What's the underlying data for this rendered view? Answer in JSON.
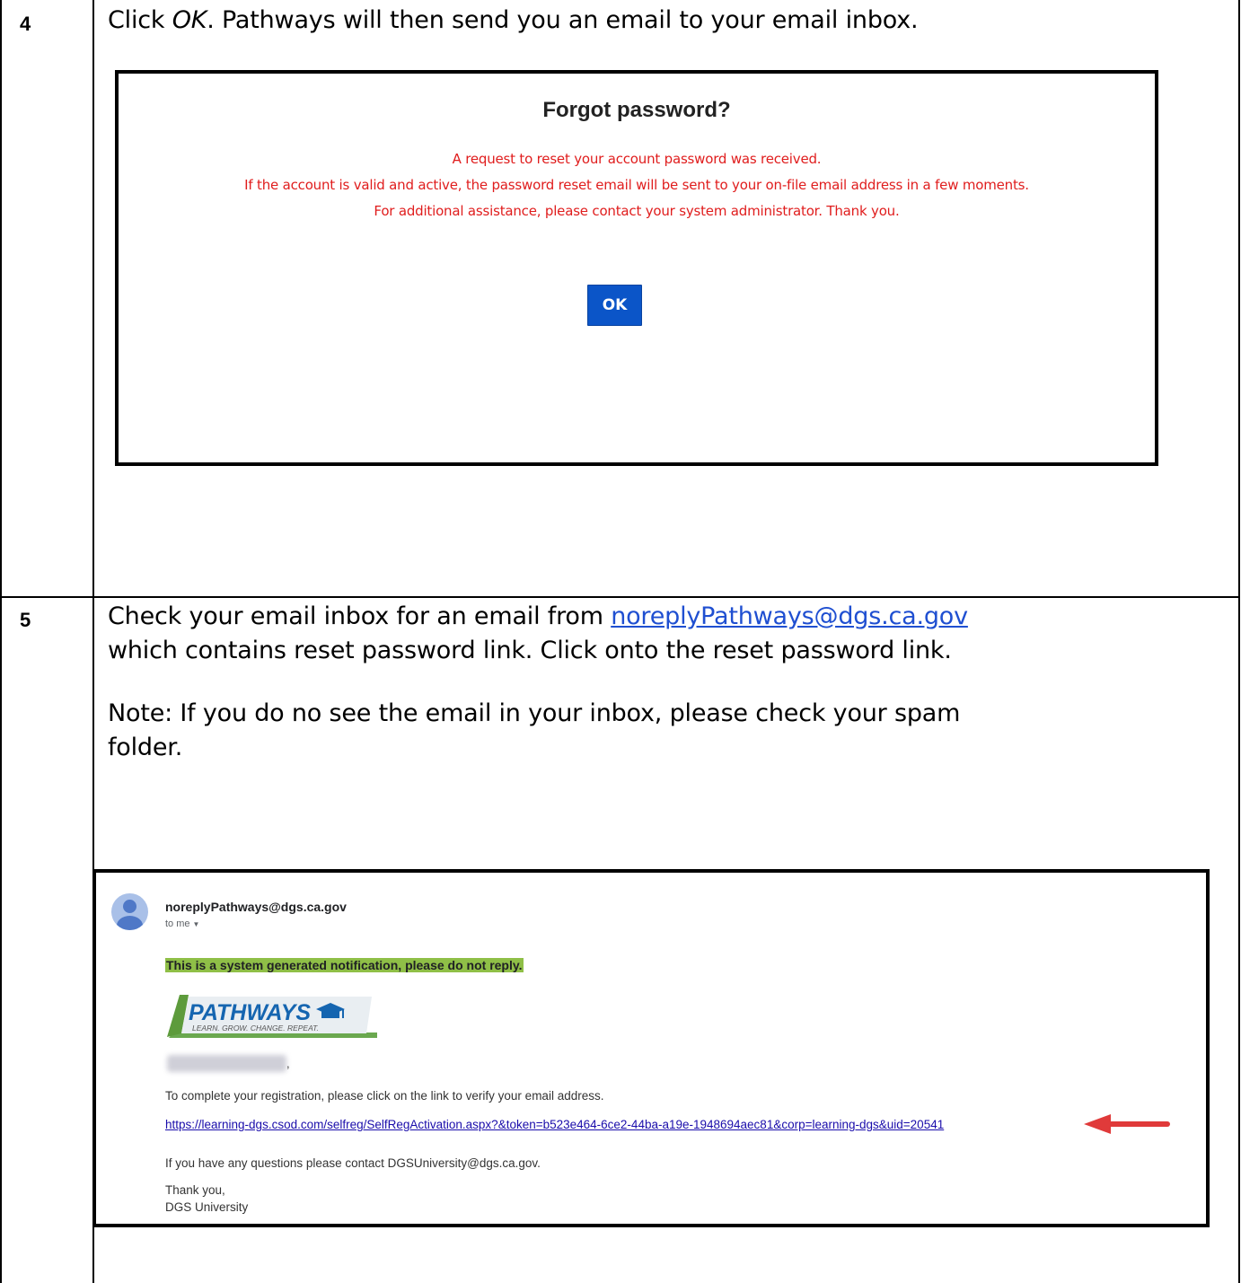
{
  "step4": {
    "number": "4",
    "instruction_prefix": "Click ",
    "instruction_em": "OK",
    "instruction_suffix": ". Pathways will then send you an email to your email inbox.",
    "dialog": {
      "title": "Forgot password?",
      "line1": "A request to reset your account password was received.",
      "line2": "If the account is valid and active, the password reset email will be sent to your on-file email address in a few moments.",
      "line3": "For additional assistance, please contact your system administrator. Thank you.",
      "ok_label": "OK",
      "ok_color": "#0b55c8",
      "message_color": "#e01d1d"
    }
  },
  "step5": {
    "number": "5",
    "line1_prefix": "Check your email inbox for an email from ",
    "line1_link": "noreplyPathways@dgs.ca.gov",
    "line2": "which contains reset password link. Click onto the reset password link.",
    "note_line1": "Note: If you do no see the email in your inbox, please check your spam",
    "note_line2": "folder.",
    "email": {
      "sender": "noreplyPathways@dgs.ca.gov",
      "recipient": "to me",
      "notice": "This is a system generated notification, please do not reply.",
      "logo_title": "PATHWAYS",
      "logo_tagline": "LEARN. GROW. CHANGE. REPEAT.",
      "greeting_comma": ",",
      "body_line": "To complete your registration, please click on the link to verify your email address.",
      "link": "https://learning-dgs.csod.com/selfreg/SelfRegActivation.aspx?&token=b523e464-6ce2-44ba-a19e-1948694aec81&corp=learning-dgs&uid=20541",
      "questions": "If you have any questions please contact DGSUniversity@dgs.ca.gov.",
      "thanks": "Thank you,",
      "signature": "DGS University",
      "notice_highlight": "#8fbf47",
      "arrow_color": "#e03a3a"
    }
  }
}
